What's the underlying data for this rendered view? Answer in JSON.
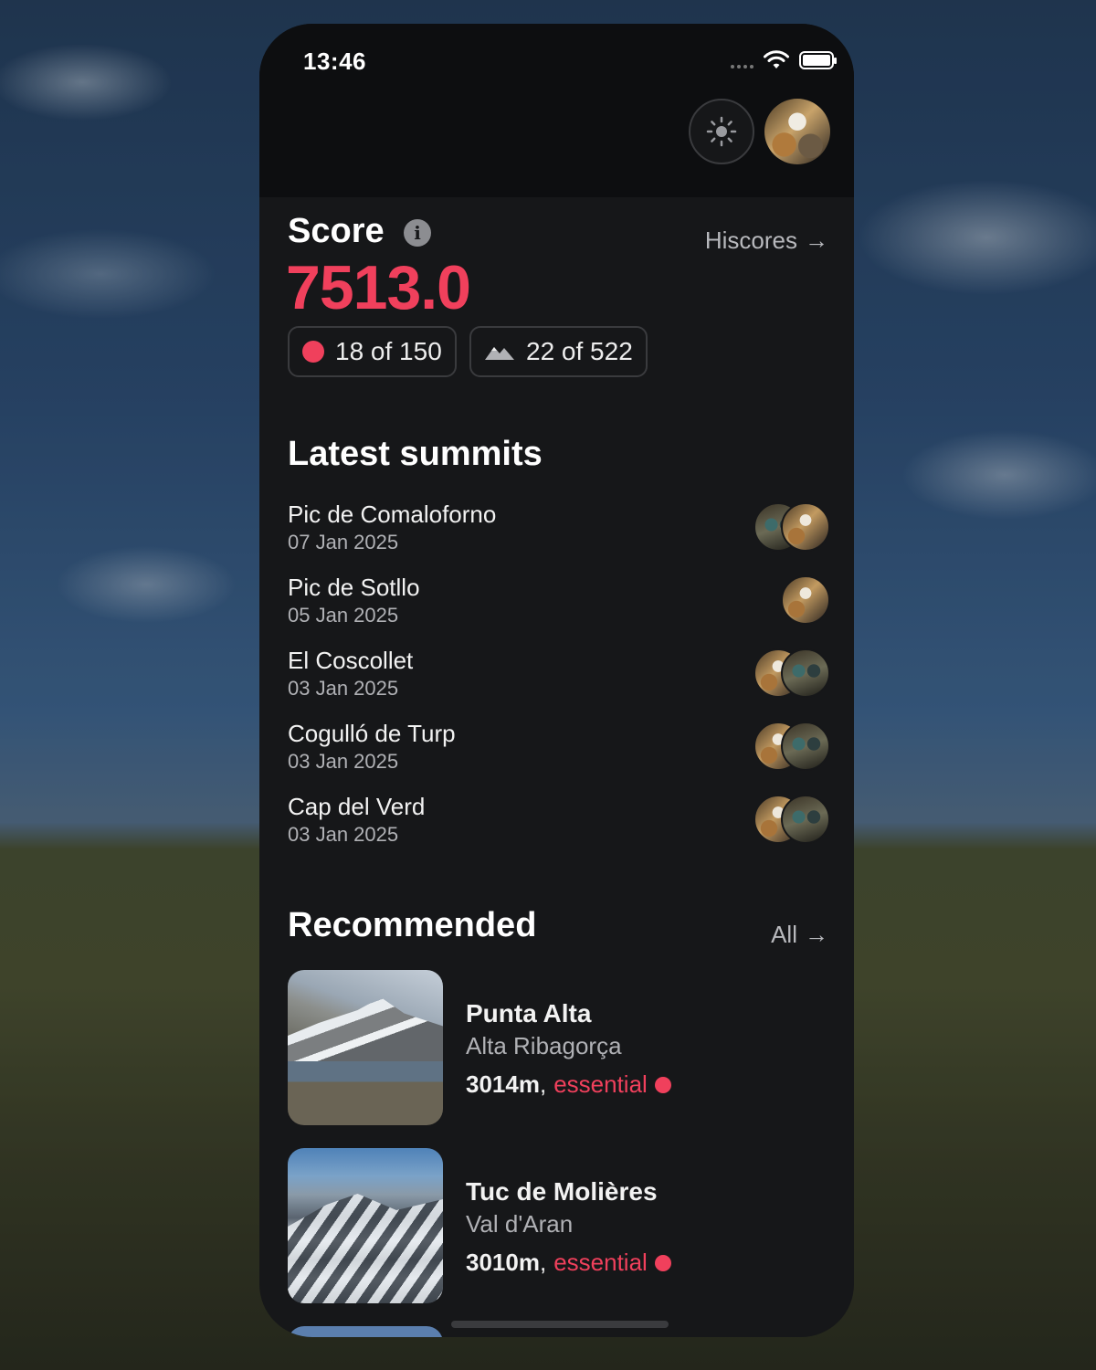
{
  "status_bar": {
    "time": "13:46"
  },
  "score": {
    "title": "Score",
    "info_glyph": "i",
    "hiscores_label": "Hiscores",
    "arrow": "→",
    "value": "7513.0",
    "essential_progress": "18 of 150",
    "peaks_progress": "22 of 522"
  },
  "latest_summits": {
    "title": "Latest summits",
    "items": [
      {
        "name": "Pic de Comaloforno",
        "date": "07 Jan 2025",
        "avatars": [
          "av-b",
          "av-a"
        ]
      },
      {
        "name": "Pic de Sotllo",
        "date": "05 Jan 2025",
        "avatars": [
          "av-a"
        ]
      },
      {
        "name": "El Coscollet",
        "date": "03 Jan 2025",
        "avatars": [
          "av-a",
          "av-b"
        ]
      },
      {
        "name": "Cogulló de Turp",
        "date": "03 Jan 2025",
        "avatars": [
          "av-a",
          "av-b"
        ]
      },
      {
        "name": "Cap del Verd",
        "date": "03 Jan 2025",
        "avatars": [
          "av-a",
          "av-b"
        ]
      }
    ]
  },
  "recommended": {
    "title": "Recommended",
    "all_label": "All",
    "items": [
      {
        "name": "Punta Alta",
        "region": "Alta Ribagorça",
        "elevation": "3014m",
        "separator": ",",
        "category": "essential"
      },
      {
        "name": "Tuc de Molières",
        "region": "Val d'Aran",
        "elevation": "3010m",
        "separator": ",",
        "category": "essential"
      }
    ]
  },
  "colors": {
    "accent": "#f0405c",
    "background": "#161719",
    "muted": "#b0b1b5"
  },
  "icons": [
    "sun-icon",
    "info-icon",
    "arrow-right-icon",
    "mountains-icon",
    "wifi-icon",
    "battery-icon"
  ]
}
